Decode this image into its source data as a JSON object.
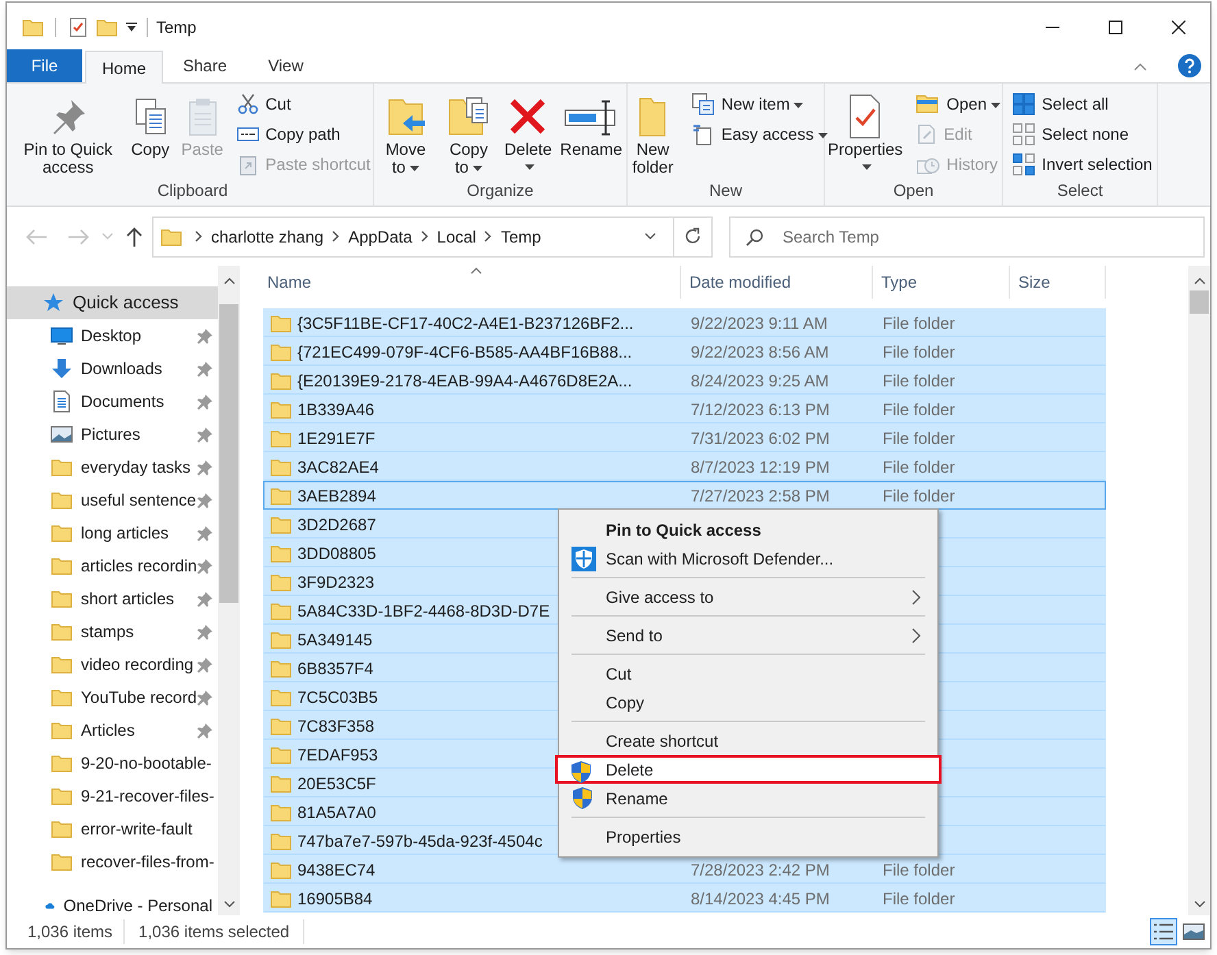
{
  "title_bar": {
    "title": "Temp"
  },
  "ribbon_tabs": [
    {
      "label": "File",
      "kind": "file",
      "selected": false
    },
    {
      "label": "Home",
      "kind": "tab",
      "selected": true
    },
    {
      "label": "Share",
      "kind": "tab",
      "selected": false
    },
    {
      "label": "View",
      "kind": "tab",
      "selected": false
    }
  ],
  "ribbon_groups": [
    {
      "label": "Clipboard",
      "columns": [
        {
          "kind": "large",
          "label": "Pin to Quick access",
          "disabled": false
        },
        {
          "kind": "large",
          "label": "Copy",
          "disabled": false
        },
        {
          "kind": "large",
          "label": "Paste",
          "disabled": true
        },
        {
          "kind": "stack",
          "items": [
            {
              "label": "Cut",
              "disabled": false
            },
            {
              "label": "Copy path",
              "disabled": false
            },
            {
              "label": "Paste shortcut",
              "disabled": true
            }
          ]
        }
      ]
    },
    {
      "label": "Organize",
      "columns": [
        {
          "kind": "large",
          "label": "Move to",
          "menu": true,
          "disabled": false
        },
        {
          "kind": "large",
          "label": "Copy to",
          "menu": true,
          "disabled": false
        },
        {
          "kind": "large",
          "label": "Delete",
          "menu": true,
          "disabled": false
        },
        {
          "kind": "large",
          "label": "Rename",
          "disabled": false
        }
      ]
    },
    {
      "label": "New",
      "columns": [
        {
          "kind": "large",
          "label": "New folder",
          "disabled": false
        },
        {
          "kind": "stack",
          "items": [
            {
              "label": "New item",
              "menu": true,
              "disabled": false
            },
            {
              "label": "Easy access",
              "menu": true,
              "disabled": false
            }
          ]
        }
      ]
    },
    {
      "label": "Open",
      "columns": [
        {
          "kind": "large",
          "label": "Properties",
          "menu": true,
          "disabled": false
        },
        {
          "kind": "stack",
          "items": [
            {
              "label": "Open",
              "menu": true,
              "disabled": false
            },
            {
              "label": "Edit",
              "disabled": true
            },
            {
              "label": "History",
              "disabled": true
            }
          ]
        }
      ]
    },
    {
      "label": "Select",
      "columns": [
        {
          "kind": "stack",
          "items": [
            {
              "label": "Select all",
              "disabled": false
            },
            {
              "label": "Select none",
              "disabled": false
            },
            {
              "label": "Invert selection",
              "disabled": false
            }
          ]
        }
      ]
    }
  ],
  "address_bar": {
    "breadcrumbs": [
      "charlotte zhang",
      "AppData",
      "Local",
      "Temp"
    ]
  },
  "search": {
    "placeholder": "Search Temp"
  },
  "navigation_pane": [
    {
      "label": "Quick access",
      "kind": "star",
      "pinned": false,
      "selected": true
    },
    {
      "label": "Desktop",
      "kind": "desktop",
      "pinned": true,
      "selected": false
    },
    {
      "label": "Downloads",
      "kind": "downloads",
      "pinned": true,
      "selected": false
    },
    {
      "label": "Documents",
      "kind": "documents",
      "pinned": true,
      "selected": false
    },
    {
      "label": "Pictures",
      "kind": "pictures",
      "pinned": true,
      "selected": false
    },
    {
      "label": "everyday tasks",
      "kind": "folder",
      "pinned": true,
      "selected": false
    },
    {
      "label": "useful sentence",
      "kind": "folder",
      "pinned": true,
      "selected": false
    },
    {
      "label": "long articles",
      "kind": "folder",
      "pinned": true,
      "selected": false
    },
    {
      "label": "articles recordin",
      "kind": "folder",
      "pinned": true,
      "selected": false
    },
    {
      "label": "short articles",
      "kind": "folder",
      "pinned": true,
      "selected": false
    },
    {
      "label": "stamps",
      "kind": "folder",
      "pinned": true,
      "selected": false
    },
    {
      "label": "video recording",
      "kind": "folder",
      "pinned": true,
      "selected": false
    },
    {
      "label": "YouTube record",
      "kind": "folder",
      "pinned": true,
      "selected": false
    },
    {
      "label": "Articles",
      "kind": "folder",
      "pinned": true,
      "selected": false
    },
    {
      "label": "9-20-no-bootable-",
      "kind": "folder",
      "pinned": false,
      "selected": false
    },
    {
      "label": "9-21-recover-files-",
      "kind": "folder",
      "pinned": false,
      "selected": false
    },
    {
      "label": "error-write-fault",
      "kind": "folder",
      "pinned": false,
      "selected": false
    },
    {
      "label": "recover-files-from-",
      "kind": "folder",
      "pinned": false,
      "selected": false
    },
    {
      "label": "OneDrive - Personal",
      "kind": "cloud",
      "pinned": false,
      "selected": false
    }
  ],
  "file_list": {
    "columns": [
      {
        "label": "Name",
        "sorted": true
      },
      {
        "label": "Date modified",
        "sorted": false
      },
      {
        "label": "Type",
        "sorted": false
      },
      {
        "label": "Size",
        "sorted": false
      }
    ],
    "rows": [
      {
        "name": "{3C5F11BE-CF17-40C2-A4E1-B237126BF2...",
        "date": "9/22/2023 9:11 AM",
        "type": "File folder",
        "selected": true,
        "focused": false
      },
      {
        "name": "{721EC499-079F-4CF6-B585-AA4BF16B88...",
        "date": "9/22/2023 8:56 AM",
        "type": "File folder",
        "selected": true,
        "focused": false
      },
      {
        "name": "{E20139E9-2178-4EAB-99A4-A4676D8E2A...",
        "date": "8/24/2023 9:25 AM",
        "type": "File folder",
        "selected": true,
        "focused": false
      },
      {
        "name": "1B339A46",
        "date": "7/12/2023 6:13 PM",
        "type": "File folder",
        "selected": true,
        "focused": false
      },
      {
        "name": "1E291E7F",
        "date": "7/31/2023 6:02 PM",
        "type": "File folder",
        "selected": true,
        "focused": false
      },
      {
        "name": "3AC82AE4",
        "date": "8/7/2023 12:19 PM",
        "type": "File folder",
        "selected": true,
        "focused": false
      },
      {
        "name": "3AEB2894",
        "date": "7/27/2023 2:58 PM",
        "type": "File folder",
        "selected": true,
        "focused": true
      },
      {
        "name": "3D2D2687",
        "selected": true,
        "focused": false
      },
      {
        "name": "3DD08805",
        "selected": true,
        "focused": false
      },
      {
        "name": "3F9D2323",
        "selected": true,
        "focused": false
      },
      {
        "name": "5A84C33D-1BF2-4468-8D3D-D7E",
        "selected": true,
        "focused": false
      },
      {
        "name": "5A349145",
        "selected": true,
        "focused": false
      },
      {
        "name": "6B8357F4",
        "selected": true,
        "focused": false
      },
      {
        "name": "7C5C03B5",
        "selected": true,
        "focused": false
      },
      {
        "name": "7C83F358",
        "selected": true,
        "focused": false
      },
      {
        "name": "7EDAF953",
        "selected": true,
        "focused": false
      },
      {
        "name": "20E53C5F",
        "selected": true,
        "focused": false
      },
      {
        "name": "81A5A7A0",
        "selected": true,
        "focused": false
      },
      {
        "name": "747ba7e7-597b-45da-923f-4504c",
        "selected": true,
        "focused": false
      },
      {
        "name": "9438EC74",
        "date": "7/28/2023 2:42 PM",
        "type": "File folder",
        "selected": true,
        "focused": false
      },
      {
        "name": "16905B84",
        "date": "8/14/2023 4:45 PM",
        "type": "File folder",
        "selected": true,
        "focused": false
      }
    ]
  },
  "context_menu": [
    {
      "kind": "item",
      "label": "Pin to Quick access",
      "default": true,
      "submenu": false,
      "highlighted": false
    },
    {
      "kind": "scan",
      "label": "Scan with Microsoft Defender...",
      "default": false,
      "submenu": false,
      "highlighted": false
    },
    {
      "kind": "separator"
    },
    {
      "kind": "item",
      "label": "Give access to",
      "default": false,
      "submenu": true,
      "highlighted": false
    },
    {
      "kind": "separator"
    },
    {
      "kind": "item",
      "label": "Send to",
      "default": false,
      "submenu": true,
      "highlighted": false
    },
    {
      "kind": "separator"
    },
    {
      "kind": "item",
      "label": "Cut",
      "default": false,
      "submenu": false,
      "highlighted": false
    },
    {
      "kind": "item",
      "label": "Copy",
      "default": false,
      "submenu": false,
      "highlighted": false
    },
    {
      "kind": "separator"
    },
    {
      "kind": "item",
      "label": "Create shortcut",
      "default": false,
      "submenu": false,
      "highlighted": false
    },
    {
      "kind": "admin",
      "label": "Delete",
      "default": false,
      "submenu": false,
      "highlighted": true
    },
    {
      "kind": "admin",
      "label": "Rename",
      "default": false,
      "submenu": false,
      "highlighted": false
    },
    {
      "kind": "separator"
    },
    {
      "kind": "item",
      "label": "Properties",
      "default": false,
      "submenu": false,
      "highlighted": false
    }
  ],
  "status_bar": {
    "item_count": "1,036 items",
    "selection": "1,036 items selected",
    "views": [
      {
        "kind": "details",
        "selected": true
      },
      {
        "kind": "large_icons",
        "selected": false
      }
    ]
  }
}
